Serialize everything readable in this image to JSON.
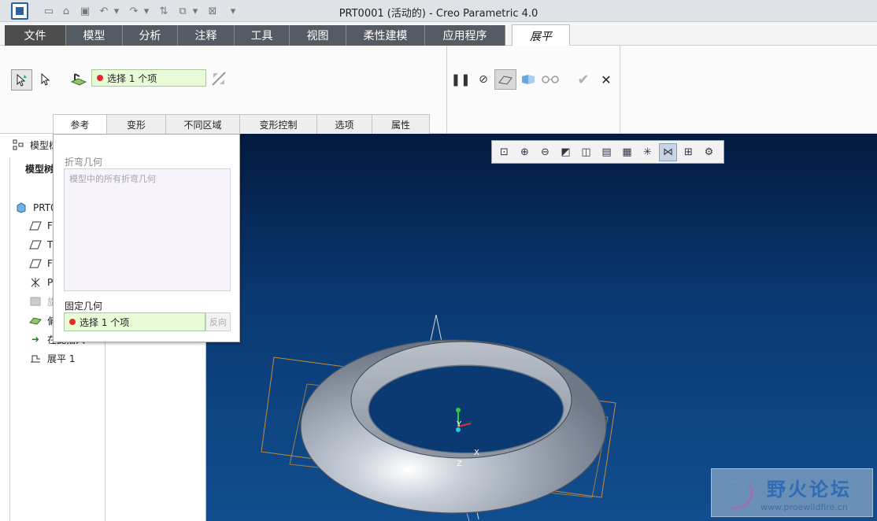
{
  "window": {
    "title": "PRT0001 (活动的) - Creo Parametric 4.0"
  },
  "ribbon_tabs": [
    {
      "label": "文件"
    },
    {
      "label": "模型"
    },
    {
      "label": "分析"
    },
    {
      "label": "注释"
    },
    {
      "label": "工具"
    },
    {
      "label": "视图"
    },
    {
      "label": "柔性建模"
    },
    {
      "label": "应用程序"
    },
    {
      "label": "展平"
    }
  ],
  "ribbon": {
    "reference_select": "选择 1 个项"
  },
  "subtabs": [
    {
      "label": "参考"
    },
    {
      "label": "变形"
    },
    {
      "label": "不同区域"
    },
    {
      "label": "变形控制"
    },
    {
      "label": "选项"
    },
    {
      "label": "属性"
    }
  ],
  "panel": {
    "bend_geometry_label": "折弯几何",
    "bend_geometry_value": "模型中的所有折弯几何",
    "fixed_geometry_label": "固定几何",
    "fixed_geometry_select": "选择 1 个项",
    "reverse_label": "反向"
  },
  "tree": {
    "header": "模型树",
    "tab_label": "模型树",
    "items": [
      {
        "label": "PRT0",
        "icon": "part-icon"
      },
      {
        "label": "F",
        "icon": "datum-plane-icon"
      },
      {
        "label": "T",
        "icon": "datum-plane-icon"
      },
      {
        "label": "F",
        "icon": "datum-plane-icon"
      },
      {
        "label": "P",
        "icon": "csys-icon"
      },
      {
        "label": "旋",
        "icon": "revolve-icon"
      },
      {
        "label": "偏",
        "icon": "offset-icon"
      },
      {
        "label": "在此插入",
        "icon": "insert-arrow-icon"
      },
      {
        "label": "展平 1",
        "icon": "flatten-icon"
      }
    ]
  },
  "viewport": {
    "axis_labels": {
      "y": "Y",
      "x": "X",
      "z": "Z"
    }
  },
  "watermark": {
    "title": "野火论坛",
    "url": "www.proewildfire.cn"
  },
  "colors": {
    "accent": "#2c5f9e",
    "select_bg": "#e8fbd7",
    "viewport_top": "#031a3f",
    "viewport_bottom": "#114e8f"
  }
}
